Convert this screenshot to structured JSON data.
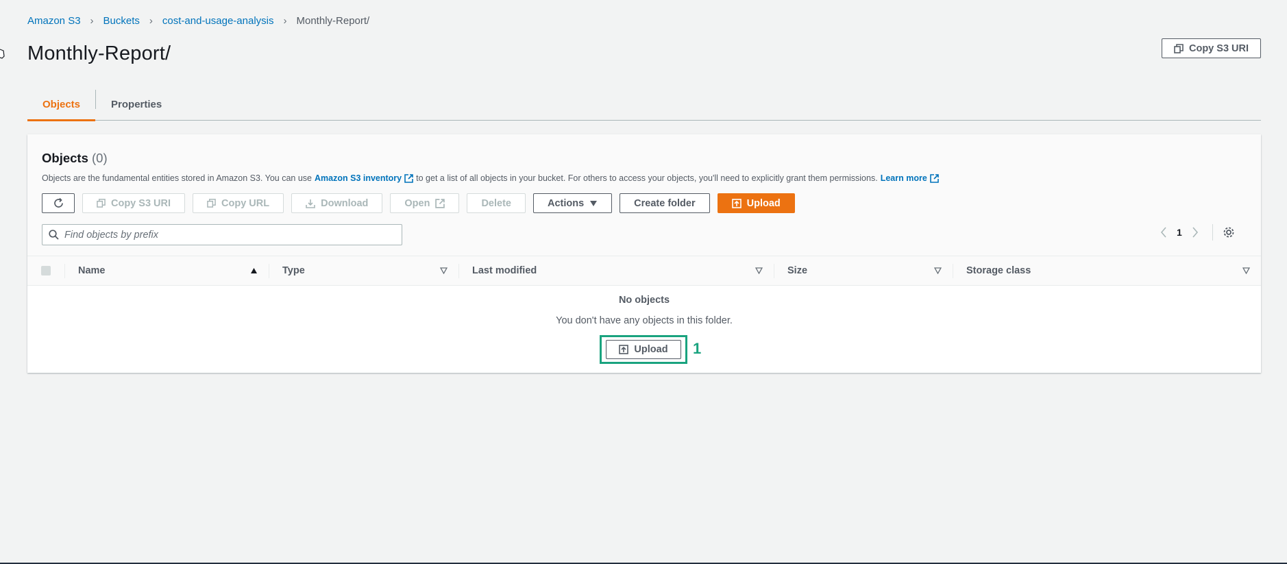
{
  "breadcrumb": {
    "items": [
      "Amazon S3",
      "Buckets",
      "cost-and-usage-analysis"
    ],
    "current": "Monthly-Report/"
  },
  "page": {
    "title": "Monthly-Report/",
    "copy_s3_uri": "Copy S3 URI"
  },
  "tabs": [
    {
      "label": "Objects",
      "active": true
    },
    {
      "label": "Properties",
      "active": false
    }
  ],
  "objects": {
    "title": "Objects",
    "count": "(0)",
    "description_pre": "Objects are the fundamental entities stored in Amazon S3. You can use",
    "inventory_link": "Amazon S3 inventory",
    "description_mid": "to get a list of all objects in your bucket. For others to access your objects, you'll need to explicitly grant them permissions.",
    "learn_more": "Learn more",
    "toolbar": {
      "copy_s3_uri": "Copy S3 URI",
      "copy_url": "Copy URL",
      "download": "Download",
      "open": "Open",
      "delete": "Delete",
      "actions": "Actions",
      "create_folder": "Create folder",
      "upload": "Upload"
    },
    "search_placeholder": "Find objects by prefix",
    "page_number": "1",
    "columns": [
      "Name",
      "Type",
      "Last modified",
      "Size",
      "Storage class"
    ],
    "empty_title": "No objects",
    "empty_subtitle": "You don't have any objects in this folder.",
    "empty_upload": "Upload",
    "step_marker": "1"
  },
  "colors": {
    "accent": "#ec7211",
    "link": "#0073bb",
    "annotation": "#1aa37f"
  }
}
